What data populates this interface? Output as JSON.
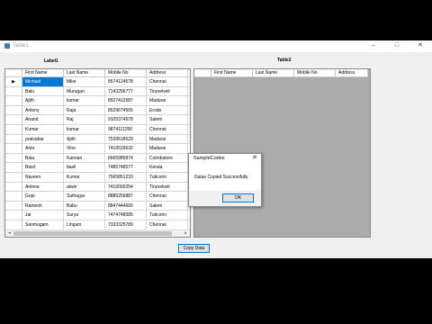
{
  "window": {
    "title": "Table1",
    "minimize": "–",
    "maximize": "□",
    "close": "✕"
  },
  "label1": "Label1",
  "table2_label": "Table2",
  "grid1": {
    "columns": [
      "First Name",
      "Last Name",
      "Mobile No",
      "Address"
    ],
    "current_row_marker": "▶",
    "rows": [
      [
        "Michael",
        "Mike",
        "8574124578",
        "Chennai"
      ],
      [
        "Balu",
        "Murugan",
        "7143256777",
        "Tirunelveli"
      ],
      [
        "Ajith",
        "kumar",
        "8527412587",
        "Madurai"
      ],
      [
        "Antony",
        "Raja",
        "8529674565",
        "Erode"
      ],
      [
        "Anand",
        "Raj",
        "9105374578",
        "Salem"
      ],
      [
        "Kumar",
        "kumar",
        "9874111256",
        "Chennai"
      ],
      [
        "pralvahar",
        "Ajith",
        "7539518529",
        "Madurai"
      ],
      [
        "Anto",
        "Vino",
        "7410529632",
        "Madurai"
      ],
      [
        "Bala",
        "Kannan",
        "6665985874",
        "Coimbatore"
      ],
      [
        "Basil",
        "basil",
        "7485748577",
        "Kerala"
      ],
      [
        "Naveen",
        "Kumar",
        "7565851233",
        "Tuticorin"
      ],
      [
        "Antrew",
        "alwin",
        "7410000254",
        "Tirunelveli"
      ],
      [
        "Gopi",
        "Suthagar",
        "8885256887",
        "Chennai"
      ],
      [
        "Ramesh",
        "Babu",
        "8847444666",
        "Salem"
      ],
      [
        "Jai",
        "Surya",
        "7474748585",
        "Tuticorin"
      ],
      [
        "Sanmugam",
        "Lingam",
        "7333325789",
        "Chennai"
      ]
    ],
    "scroll_left": "◂",
    "scroll_right": "▸"
  },
  "grid2": {
    "columns": [
      "First Name",
      "Last Name",
      "Mobile No",
      "Address"
    ]
  },
  "copy_button": "Copy Data",
  "dialog": {
    "title": "SampleCodes",
    "close": "✕",
    "message": "Datas Copied Successfully",
    "ok": "OK"
  }
}
